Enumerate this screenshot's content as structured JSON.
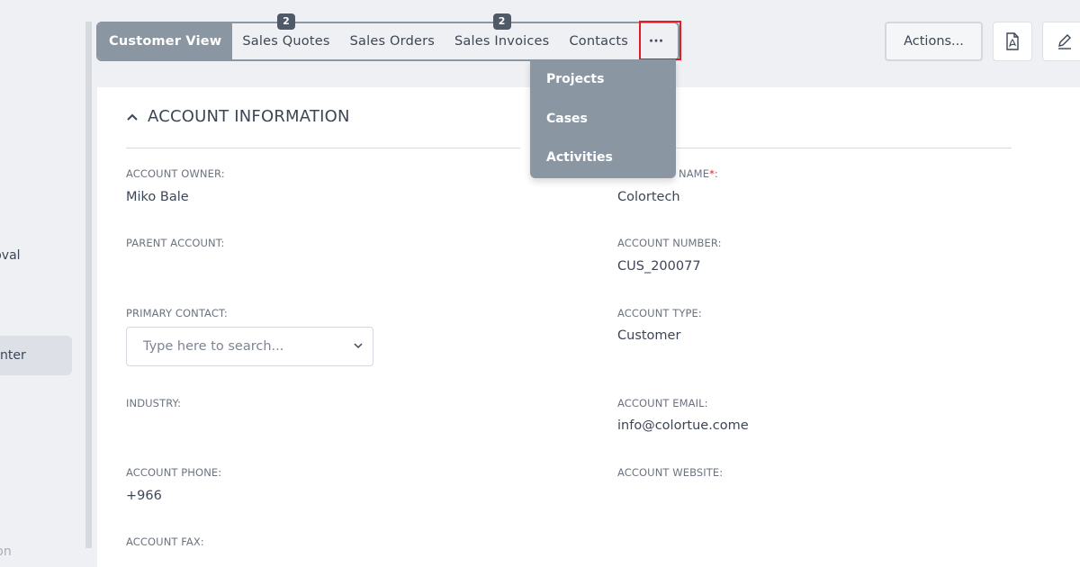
{
  "sidebar": {
    "items": [
      {
        "label": "pproval"
      },
      {
        "label": "nter"
      },
      {
        "label": "zation"
      }
    ]
  },
  "tabs": [
    {
      "label": "Customer View",
      "badge": ""
    },
    {
      "label": "Sales Quotes",
      "badge": "2"
    },
    {
      "label": "Sales Orders",
      "badge": ""
    },
    {
      "label": "Sales Invoices",
      "badge": "2"
    },
    {
      "label": "Contacts",
      "badge": ""
    },
    {
      "label": "···",
      "badge": ""
    }
  ],
  "header": {
    "actions_label": "Actions...",
    "pdf_icon": "pdf-icon",
    "edit_icon": "pencil-icon"
  },
  "dropdown": {
    "items": [
      {
        "label": "Projects"
      },
      {
        "label": "Cases"
      },
      {
        "label": "Activities"
      }
    ]
  },
  "section": {
    "title": "ACCOUNT INFORMATION"
  },
  "fields": {
    "account_owner": {
      "label": "ACCOUNT OWNER:",
      "value": "Miko Bale"
    },
    "account_name": {
      "label": "NAME",
      "required": "*",
      "colon": ":",
      "value": "Colortech"
    },
    "parent_account": {
      "label": "PARENT ACCOUNT:",
      "value": ""
    },
    "account_number": {
      "label": "ACCOUNT NUMBER:",
      "value": "CUS_200077"
    },
    "primary_contact": {
      "label": "PRIMARY CONTACT:",
      "placeholder": "Type here to search..."
    },
    "account_type": {
      "label": "ACCOUNT TYPE:",
      "value": "Customer"
    },
    "industry": {
      "label": "INDUSTRY:",
      "value": ""
    },
    "account_email": {
      "label": "ACCOUNT EMAIL:",
      "value": "info@colortue.come"
    },
    "account_phone": {
      "label": "ACCOUNT PHONE:",
      "value": "+966"
    },
    "account_website": {
      "label": "ACCOUNT WEBSITE:",
      "value": ""
    },
    "account_fax": {
      "label": "ACCOUNT FAX:",
      "value": ""
    }
  },
  "colors": {
    "tab_active_bg": "#8b96a3",
    "badge_bg": "#4f5968",
    "highlight": "#e21b25",
    "card_bg": "#ffffff",
    "page_bg": "#eef0f4"
  }
}
